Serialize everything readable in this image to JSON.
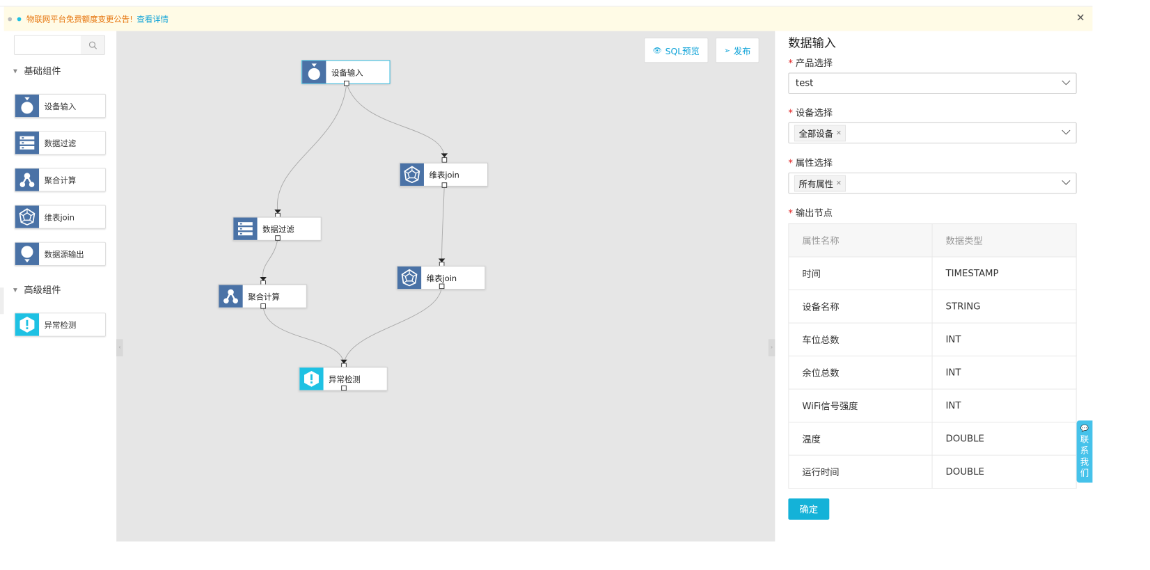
{
  "notice": {
    "text": "物联网平台免费额度变更公告!",
    "link": "查看详情",
    "dot_colors": [
      "#bbbbbb",
      "#1ec1e3"
    ]
  },
  "sidebar": {
    "search_placeholder": "",
    "groups": [
      {
        "title": "基础组件",
        "items": [
          {
            "label": "设备输入",
            "icon": "device-input-icon"
          },
          {
            "label": "数据过滤",
            "icon": "data-filter-icon"
          },
          {
            "label": "聚合计算",
            "icon": "aggregate-icon"
          },
          {
            "label": "维表join",
            "icon": "dim-join-icon"
          },
          {
            "label": "数据源输出",
            "icon": "datasource-output-icon"
          }
        ]
      },
      {
        "title": "高级组件",
        "items": [
          {
            "label": "异常检测",
            "icon": "anomaly-detect-icon"
          }
        ]
      }
    ]
  },
  "toolbar": {
    "sql_preview": "SQL预览",
    "publish": "发布"
  },
  "nodes": [
    {
      "id": "n1",
      "label": "设备输入",
      "icon": "device-input-icon",
      "selected": true
    },
    {
      "id": "n2",
      "label": "维表join",
      "icon": "dim-join-icon"
    },
    {
      "id": "n3",
      "label": "数据过滤",
      "icon": "data-filter-icon"
    },
    {
      "id": "n4",
      "label": "聚合计算",
      "icon": "aggregate-icon"
    },
    {
      "id": "n5",
      "label": "维表join",
      "icon": "dim-join-icon"
    },
    {
      "id": "n6",
      "label": "异常检测",
      "icon": "anomaly-detect-icon"
    }
  ],
  "panel": {
    "title": "数据输入",
    "product_label": "产品选择",
    "product_value": "test",
    "device_label": "设备选择",
    "device_tag": "全部设备",
    "attr_label": "属性选择",
    "attr_tag": "所有属性",
    "output_label": "输出节点",
    "table": {
      "headers": [
        "属性名称",
        "数据类型"
      ],
      "rows": [
        [
          "时间",
          "TIMESTAMP"
        ],
        [
          "设备名称",
          "STRING"
        ],
        [
          "车位总数",
          "INT"
        ],
        [
          "余位总数",
          "INT"
        ],
        [
          "WiFi信号强度",
          "INT"
        ],
        [
          "温度",
          "DOUBLE"
        ],
        [
          "运行时间",
          "DOUBLE"
        ]
      ]
    },
    "confirm": "确定"
  },
  "contact": [
    "联",
    "系",
    "我",
    "们"
  ],
  "colors": {
    "accent": "#14b2d8",
    "node_icon": "#4a72a6",
    "anomaly_icon": "#1ec1e3",
    "notice_text": "#e6740c",
    "canvas_bg": "#e6e6e6"
  }
}
